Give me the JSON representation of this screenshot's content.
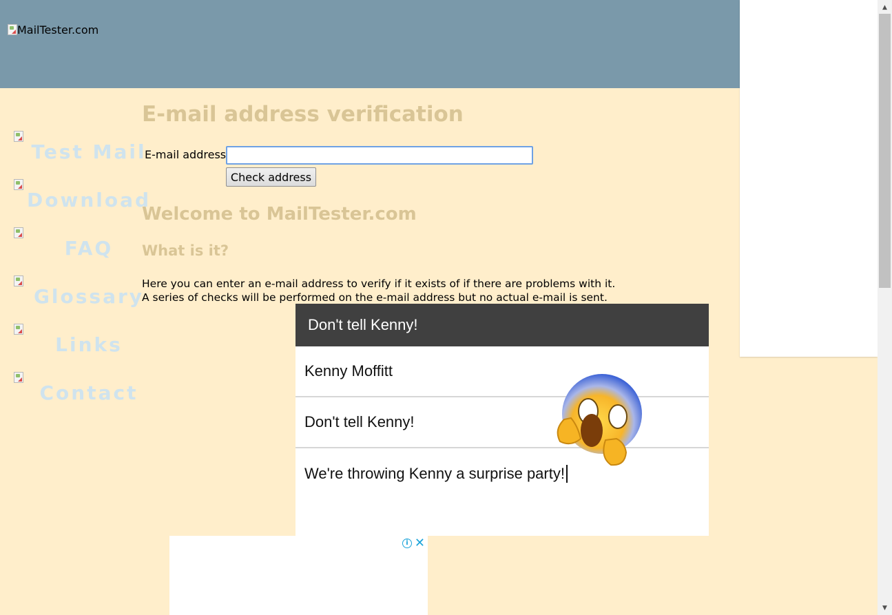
{
  "header": {
    "logo_alt": "MailTester.com"
  },
  "nav": {
    "items": [
      {
        "label": "Test Mail"
      },
      {
        "label": "Download"
      },
      {
        "label": "FAQ"
      },
      {
        "label": "Glossary"
      },
      {
        "label": "Links"
      },
      {
        "label": "Contact"
      }
    ]
  },
  "main": {
    "title": "E-mail address verification",
    "form": {
      "email_label": "E-mail address",
      "email_value": "",
      "submit_label": "Check address"
    },
    "welcome": "Welcome to MailTester.com",
    "what_heading": "What is it?",
    "description_line1": "Here you can enter an e-mail address to verify if it exists of if there are problems with it.",
    "description_line2": "A series of checks will be performed on the e-mail address but no actual e-mail is sent."
  },
  "video_ad": {
    "header": "Don't tell Kenny!",
    "row1": "Kenny Moffitt",
    "row2": "Don't tell Kenny!",
    "row3": "We're throwing Kenny a surprise party!"
  },
  "ad_bottom": {
    "info_icon": "i",
    "close_icon": "✕"
  },
  "colors": {
    "page_bg": "#ffeecb",
    "header_bg": "#7a99aa",
    "heading": "#d9c596",
    "nav_text": "#cfe3ee",
    "ad_accent": "#1aa3d9"
  }
}
